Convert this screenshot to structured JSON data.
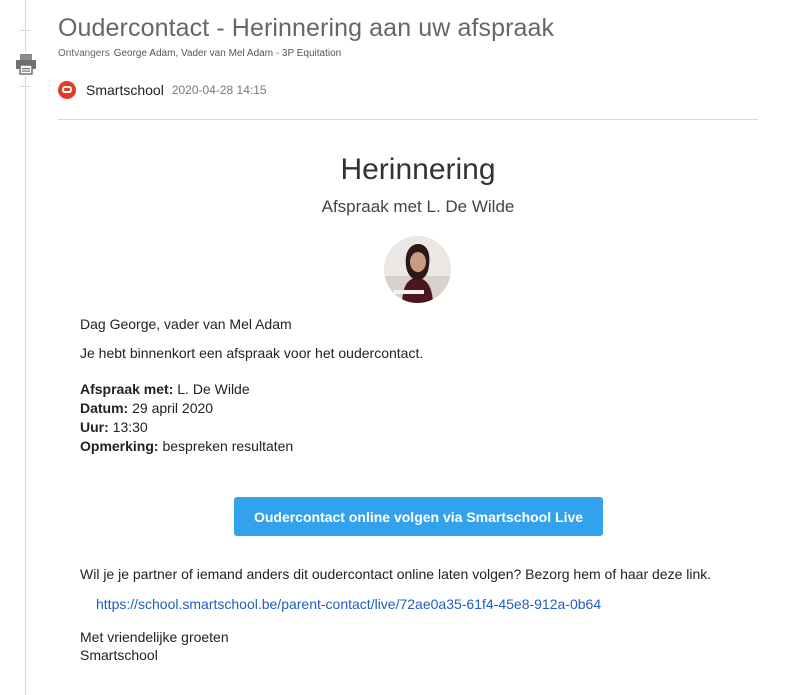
{
  "message": {
    "title": "Oudercontact - Herinnering aan uw afspraak",
    "recipients_label": "Ontvangers",
    "recipients": "George Adam, Vader van Mel Adam - 3P Equitation",
    "sender": "Smartschool",
    "timestamp": "2020-04-28 14:15"
  },
  "email": {
    "heading": "Herinnering",
    "subheading": "Afspraak met L. De Wilde",
    "greeting": "Dag George, vader van Mel Adam",
    "intro": "Je hebt binnenkort een afspraak voor het oudercontact.",
    "details": [
      {
        "label": "Afspraak met:",
        "value": "L. De Wilde"
      },
      {
        "label": "Datum:",
        "value": "29 april 2020"
      },
      {
        "label": "Uur:",
        "value": "13:30"
      },
      {
        "label": "Opmerking:",
        "value": "bespreken resultaten"
      }
    ],
    "button_label": "Oudercontact online volgen via Smartschool Live",
    "partner_text": "Wil je je partner of iemand anders dit oudercontact online laten volgen? Bezorg hem of haar deze link.",
    "link": "https://school.smartschool.be/parent-contact/live/72ae0a35-61f4-45e8-912a-0b64",
    "closing_line1": "Met vriendelijke groeten",
    "closing_line2": "Smartschool"
  },
  "colors": {
    "button": "#33a2ed",
    "link": "#1f5ec1",
    "logo": "#e53a24"
  },
  "icons": [
    "print-icon",
    "smartschool-logo-icon"
  ]
}
